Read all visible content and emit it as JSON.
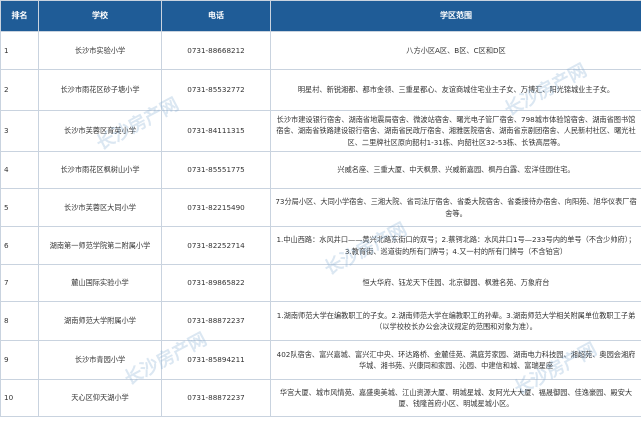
{
  "watermark": "长沙房产网",
  "columns": {
    "index": "排名",
    "school": "学校",
    "phone": "电话",
    "area": "学区范围"
  },
  "rows": [
    {
      "index": "1",
      "school": "长沙市实验小学",
      "phone": "0731-88668212",
      "area": "八方小区A区、B区、C区和D区"
    },
    {
      "index": "2",
      "school": "长沙市雨花区砂子塘小学",
      "phone": "0731-85532772",
      "area": "明星村、新锐湘都、都市金领、三重星都心、友谊商城住宅业主子女、万博汇、阳光锦城业主子女。"
    },
    {
      "index": "3",
      "school": "长沙市芙蓉区育英小学",
      "phone": "0731-84111315",
      "area": "长沙市建设银行宿舍、湖南省地震局宿舍、微波站宿舍、曙光电子管厂宿舍、798城市体验馆宿舍、湖南省图书馆宿舍、湖南省铁路建设银行宿舍、湖南省民政厅宿舍、湘雅医院宿舍、湖南省京剧团宿舍、人民新村社区、曙光社区、二里牌社区原向韶村1-31栋、向韶社区32-53栋、长铁高层等。"
    },
    {
      "index": "4",
      "school": "长沙市雨花区枫树山小学",
      "phone": "0731-85551775",
      "area": "兴威名座、三重大厦、中天枫景、兴威新嘉园、枫丹白露、宏洋佳园住宅。"
    },
    {
      "index": "5",
      "school": "长沙市芙蓉区大同小学",
      "phone": "0731-82215490",
      "area": "73分局小区、大同小学宿舍、三湘大院、省司法厅宿舍、省委大院宿舍、省委接待办宿舍、向阳苑、旭华仪表厂宿舍等。"
    },
    {
      "index": "6",
      "school": "湖南第一师范学院第二附属小学",
      "phone": "0731-82252714",
      "area": "1.中山西路：水风井口——黄兴北路东街口的双号；2.蔡锷北路：水风井口1号—233号内的单号（不含少帅府）；3.教育街、巡道街的所有门牌号；4.又一村的所有门牌号（不含铂宫）"
    },
    {
      "index": "7",
      "school": "麓山国际实验小学",
      "phone": "0731-89865822",
      "area": "恒大华府、钰龙天下佳园、北京御园、枫雅名苑、万象府台"
    },
    {
      "index": "8",
      "school": "湖南师范大学附属小学",
      "phone": "0731-88872237",
      "area": "1.湖南师范大学在编教职工的子女。2.湖南师范大学在编教职工的孙辈。3.湖南师范大学相关附属单位教职工子弟（以学校校长办公会决议规定的范围和对象为准）。"
    },
    {
      "index": "9",
      "school": "长沙市青园小学",
      "phone": "0731-85894211",
      "area": "402队宿舍、富兴嘉城、富兴汇中央、环达路桥、金麓佳苑、满庭芳家园、湖南电力科技园、湘超苑、奥园会湘府华城、湘书苑、兴康同和家园、沁园、中建信和城、富瑞星座"
    },
    {
      "index": "10",
      "school": "天心区仰天湖小学",
      "phone": "0731-88872237",
      "area": "华宫大厦、城市风情苑、嘉盛奥美城、江山资源大厦、明城星城、友阿光大大厦、福晟御园、佳逸豪园、殿安大厦、钱隆首府小区、明城星城小区。"
    }
  ]
}
